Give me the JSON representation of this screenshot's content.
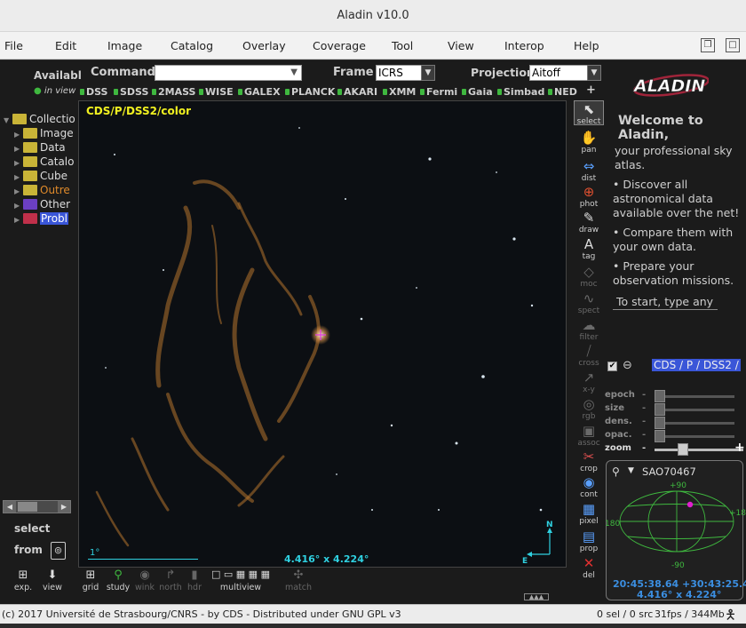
{
  "window": {
    "title": "Aladin v10.0"
  },
  "menu": [
    "File",
    "Edit",
    "Image",
    "Catalog",
    "Overlay",
    "Coverage",
    "Tool",
    "View",
    "Interop",
    "Help"
  ],
  "left": {
    "available": "Availabl",
    "in_view": "in view",
    "tree": [
      {
        "label": "Collectio",
        "color": "#c9b437",
        "tri": "▼"
      },
      {
        "label": "Image",
        "color": "#c9b437",
        "tri": "▶"
      },
      {
        "label": "Data",
        "color": "#c9b437",
        "tri": "▶"
      },
      {
        "label": "Catalo",
        "color": "#c9b437",
        "tri": "▶"
      },
      {
        "label": "Cube",
        "color": "#c9b437",
        "tri": "▶"
      },
      {
        "label": "Outre",
        "color": "#c9b437",
        "tri": "▶",
        "text_color": "#e08a2a"
      },
      {
        "label": "Other",
        "color": "#6b3fc2",
        "tri": "▶"
      },
      {
        "label": "Probl",
        "color": "#c0304a",
        "tri": "▶",
        "selected": true
      }
    ],
    "select": "select",
    "from": "from",
    "exp": "exp.",
    "view": "view"
  },
  "toolbar": {
    "command_label": "Command",
    "command_value": "",
    "frame_label": "Frame",
    "frame_value": "ICRS",
    "projection_label": "Projection",
    "projection_value": "Aitoff",
    "surveys": [
      "DSS",
      "SDSS",
      "2MASS",
      "WISE",
      "GALEX",
      "PLANCK",
      "AKARI",
      "XMM",
      "Fermi",
      "Gaia",
      "Simbad",
      "NED"
    ],
    "plus": "+"
  },
  "view": {
    "survey_label": "CDS/P/DSS2/color",
    "scale_label": "1°",
    "fov": "4.416° x 4.224°",
    "compass_n": "N",
    "compass_e": "E"
  },
  "tools": [
    {
      "id": "select",
      "label": "select",
      "icon": "⬉",
      "enabled": true
    },
    {
      "id": "pan",
      "label": "pan",
      "icon": "✋",
      "enabled": true
    },
    {
      "id": "dist",
      "label": "dist",
      "icon": "⇔",
      "enabled": true
    },
    {
      "id": "phot",
      "label": "phot",
      "icon": "⊕",
      "enabled": true
    },
    {
      "id": "draw",
      "label": "draw",
      "icon": "✎",
      "enabled": true
    },
    {
      "id": "tag",
      "label": "tag",
      "icon": "A",
      "enabled": true
    },
    {
      "id": "moc",
      "label": "moc",
      "icon": "◇",
      "enabled": false
    },
    {
      "id": "spect",
      "label": "spect",
      "icon": "∿",
      "enabled": false
    },
    {
      "id": "filter",
      "label": "filter",
      "icon": "☁",
      "enabled": false
    },
    {
      "id": "cross",
      "label": "cross",
      "icon": "⧸",
      "enabled": false
    },
    {
      "id": "xy",
      "label": "x-y",
      "icon": "↗",
      "enabled": false
    },
    {
      "id": "rgb",
      "label": "rgb",
      "icon": "◎",
      "enabled": false
    },
    {
      "id": "assoc",
      "label": "assoc",
      "icon": "▣",
      "enabled": false
    },
    {
      "id": "crop",
      "label": "crop",
      "icon": "✂",
      "enabled": true
    },
    {
      "id": "cont",
      "label": "cont",
      "icon": "◉",
      "enabled": true
    },
    {
      "id": "pixel",
      "label": "pixel",
      "icon": "▦",
      "enabled": true
    },
    {
      "id": "prop",
      "label": "prop",
      "icon": "▤",
      "enabled": true
    },
    {
      "id": "del",
      "label": "del",
      "icon": "✕",
      "enabled": true
    }
  ],
  "bottom_tools": [
    {
      "label": "grid",
      "icon": "⊞",
      "enabled": true
    },
    {
      "label": "study",
      "icon": "⚲",
      "enabled": true
    },
    {
      "label": "wink",
      "icon": "◉",
      "enabled": false
    },
    {
      "label": "north",
      "icon": "↱",
      "enabled": false
    },
    {
      "label": "hdr",
      "icon": "▮",
      "enabled": false
    },
    {
      "label": "multiview",
      "icon": "□ ▭ ▦ ▦ ▦",
      "enabled": true
    },
    {
      "label": "match",
      "icon": "✣",
      "enabled": false
    }
  ],
  "welcome": {
    "title": "Welcome to Aladin,",
    "subtitle": "your professional sky atlas.",
    "bullet1": "• Discover all astronomical data available over the net!",
    "bullet2": "• Compare them with your own data.",
    "bullet3": "• Prepare your observation missions.",
    "start": "To start, type any"
  },
  "layer": {
    "name": "CDS / P / DSS2 /"
  },
  "sliders": [
    {
      "label": "epoch",
      "value": 0.0
    },
    {
      "label": "size",
      "value": 0.0
    },
    {
      "label": "dens.",
      "value": 0.0
    },
    {
      "label": "opac.",
      "value": 0.0
    },
    {
      "label": "zoom",
      "value": 0.25
    }
  ],
  "minimap": {
    "target": "SAO70467",
    "lat_top": "+90",
    "lat_bottom": "-90",
    "lon_left": "180",
    "lon_right": "+18",
    "coords": "20:45:38.64 +30:43:25.4",
    "fov": "4.416° x 4.224°"
  },
  "status": {
    "copyright": "(c) 2017 Université de Strasbourg/CNRS - by CDS - Distributed under GNU GPL v3",
    "sel": "0 sel / 0 src",
    "perf": "31fps / 344Mb"
  },
  "colors": {
    "accent_yellow": "#e8e828",
    "cyan": "#2fd0e0",
    "selected_blue": "#3a56d8",
    "grid_green": "#3fb83f"
  }
}
